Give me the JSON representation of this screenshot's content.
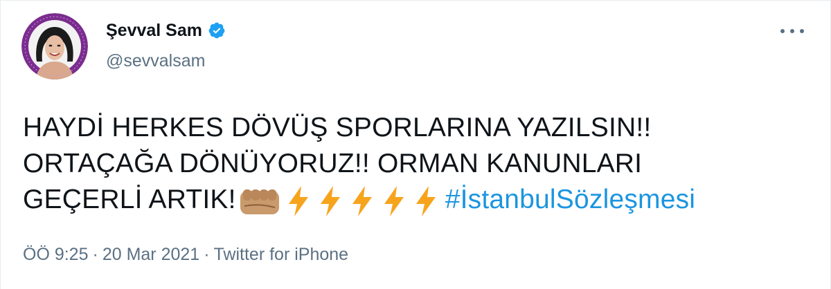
{
  "author": {
    "display_name": "Şevval Sam",
    "handle": "@sevvalsam",
    "verified": true,
    "avatar_icon": "profile-photo"
  },
  "tweet": {
    "lines": [
      "HAYDİ HERKES DÖVÜŞ SPORLARINA YAZILSIN!!",
      "ORTAÇAĞA DÖNÜYORUZ!! ORMAN KANUNLARI",
      "GEÇERLİ ARTIK!"
    ],
    "emojis": [
      "oncoming-fist",
      "high-voltage",
      "high-voltage",
      "high-voltage",
      "high-voltage",
      "high-voltage"
    ],
    "hashtag": "#İstanbulSözleşmesi"
  },
  "meta": {
    "time": "ÖÖ 9:25",
    "separator": "·",
    "date": "20 Mar 2021",
    "source": "Twitter for iPhone"
  },
  "colors": {
    "text": "#0f1419",
    "secondary": "#5b7083",
    "link": "#1b95e0",
    "verified": "#1da1f2",
    "avatar_ring": "#7b2c8f"
  },
  "icons": {
    "more": "more-options-icon",
    "verified": "verified-badge-icon"
  }
}
